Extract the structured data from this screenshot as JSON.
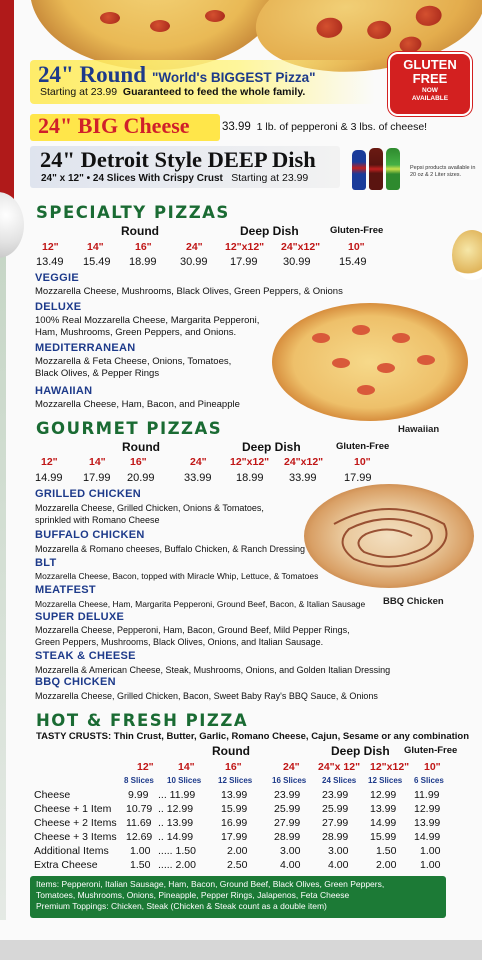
{
  "header": {
    "round": {
      "title": "24\" Round",
      "tagline": "\"World's BIGGEST Pizza\"",
      "start": "Starting at 23.99",
      "guarantee": "Guaranteed to feed the whole family."
    },
    "gluten_badge": {
      "line1": "GLUTEN",
      "line2": "FREE",
      "line3": "NOW",
      "line4": "AVAILABLE"
    },
    "big_cheese": {
      "title": "24\" BIG Cheese",
      "price": "33.99",
      "desc": "1 lb. of pepperoni & 3 lbs. of cheese!"
    },
    "detroit": {
      "title": "24\" Detroit Style DEEP Dish",
      "sub": "24\" x 12\" • 24 Slices With Crispy Crust",
      "start": "Starting at 23.99"
    },
    "pepsi_note": "Pepsi products available in 20 oz & 2 Liter sizes."
  },
  "specialty": {
    "title": "SPECIALTY PIZZAS",
    "groups": {
      "round": "Round",
      "deep": "Deep Dish",
      "gf": "Gluten-Free"
    },
    "sizes": [
      "12\"",
      "14\"",
      "16\"",
      "24\"",
      "12\"x12\"",
      "24\"x12\"",
      "10\""
    ],
    "prices": [
      "13.49",
      "15.49",
      "18.99",
      "30.99",
      "17.99",
      "30.99",
      "15.49"
    ],
    "items": [
      {
        "name": "VEGGIE",
        "desc": "Mozzarella Cheese, Mushrooms, Black Olives, Green Peppers, & Onions"
      },
      {
        "name": "DELUXE",
        "desc1": "100% Real Mozzarella Cheese, Margarita Pepperoni,",
        "desc2": "Ham, Mushrooms, Green Peppers, and Onions."
      },
      {
        "name": "MEDITERRANEAN",
        "desc1": "Mozzarella & Feta Cheese, Onions, Tomatoes,",
        "desc2": "Black Olives, & Pepper Rings"
      },
      {
        "name": "HAWAIIAN",
        "desc": "Mozzarella Cheese, Ham, Bacon, and Pineapple"
      }
    ],
    "photo_caption": "Hawaiian"
  },
  "gourmet": {
    "title": "GOURMET PIZZAS",
    "groups": {
      "round": "Round",
      "deep": "Deep Dish",
      "gf": "Gluten-Free"
    },
    "sizes": [
      "12\"",
      "14\"",
      "16\"",
      "24\"",
      "12\"x12\"",
      "24\"x12\"",
      "10\""
    ],
    "prices": [
      "14.99",
      "17.99",
      "20.99",
      "33.99",
      "18.99",
      "33.99",
      "17.99"
    ],
    "items": [
      {
        "name": "GRILLED CHICKEN",
        "desc1": "Mozzarella Cheese, Grilled Chicken, Onions & Tomatoes,",
        "desc2": "sprinkled with Romano Cheese"
      },
      {
        "name": "BUFFALO CHICKEN",
        "desc": "Mozzarella & Romano cheeses, Buffalo Chicken, & Ranch Dressing"
      },
      {
        "name": "BLT",
        "desc": "Mozzarella Cheese, Bacon, topped with Miracle Whip, Lettuce, & Tomatoes"
      },
      {
        "name": "MEATFEST",
        "desc": "Mozzarella Cheese, Ham, Margarita Pepperoni, Ground Beef, Bacon, & Italian Sausage"
      },
      {
        "name": "SUPER DELUXE",
        "desc1": "Mozzarella Cheese, Pepperoni, Ham, Bacon, Ground Beef, Mild Pepper Rings,",
        "desc2": "Green Peppers, Mushrooms, Black Olives, Onions, and Italian Sausage."
      },
      {
        "name": "STEAK & CHEESE",
        "desc": "Mozzarella & American Cheese, Steak, Mushrooms, Onions, and Golden Italian Dressing"
      },
      {
        "name": "BBQ CHICKEN",
        "desc": "Mozzarella Cheese, Grilled Chicken, Bacon, Sweet Baby Ray's BBQ Sauce, & Onions"
      }
    ],
    "photo_caption": "BBQ Chicken"
  },
  "hot_fresh": {
    "title": "HOT & FRESH PIZZA",
    "crusts_label": "TASTY CRUSTS:",
    "crusts": "Thin Crust, Butter, Garlic, Romano Cheese, Cajun, Sesame or any combination",
    "groups": {
      "round": "Round",
      "deep": "Deep Dish",
      "gf": "Gluten-Free"
    },
    "sizes": [
      "12\"",
      "14\"",
      "16\"",
      "24\"",
      "24\"x 12\"",
      "12\"x12\"",
      "10\""
    ],
    "slices": [
      "8 Slices",
      "10 Slices",
      "12 Slices",
      "16 Slices",
      "24 Slices",
      "12 Slices",
      "6 Slices"
    ],
    "rows": [
      {
        "label": "Cheese",
        "c1": "9.99",
        "c2": "... 11.99",
        "c3": "13.99",
        "c4": "23.99",
        "c5": "23.99",
        "c6": "12.99",
        "c7": "11.99"
      },
      {
        "label": "Cheese + 1 Item",
        "c1": "10.79",
        "c2": ".. 12.99",
        "c3": "15.99",
        "c4": "25.99",
        "c5": "25.99",
        "c6": "13.99",
        "c7": "12.99"
      },
      {
        "label": "Cheese + 2 Items",
        "c1": "11.69",
        "c2": ".. 13.99",
        "c3": "16.99",
        "c4": "27.99",
        "c5": "27.99",
        "c6": "14.99",
        "c7": "13.99"
      },
      {
        "label": "Cheese + 3 Items",
        "c1": "12.69",
        "c2": ".. 14.99",
        "c3": "17.99",
        "c4": "28.99",
        "c5": "28.99",
        "c6": "15.99",
        "c7": "14.99"
      },
      {
        "label": "Additional Items",
        "c1": "1.00",
        "c2": "..... 1.50",
        "c3": "2.00",
        "c4": "3.00",
        "c5": "3.00",
        "c6": "1.50",
        "c7": "1.00"
      },
      {
        "label": "Extra Cheese",
        "c1": "1.50",
        "c2": "..... 2.00",
        "c3": "2.50",
        "c4": "4.00",
        "c5": "4.00",
        "c6": "2.00",
        "c7": "1.00"
      }
    ],
    "items_box": {
      "line1": "Items: Pepperoni, Italian Sausage, Ham, Bacon, Ground Beef, Black Olives, Green Peppers,",
      "line2": "Tomatoes, Mushrooms, Onions, Pineapple, Pepper Rings, Jalapenos, Feta Cheese",
      "line3": "Premium Toppings: Chicken, Steak (Chicken & Steak count as a double item)"
    }
  },
  "colors": {
    "red": "#c01616",
    "navy": "#1d3a8a",
    "green": "#1a6b33",
    "yellow": "#ffe64a"
  }
}
